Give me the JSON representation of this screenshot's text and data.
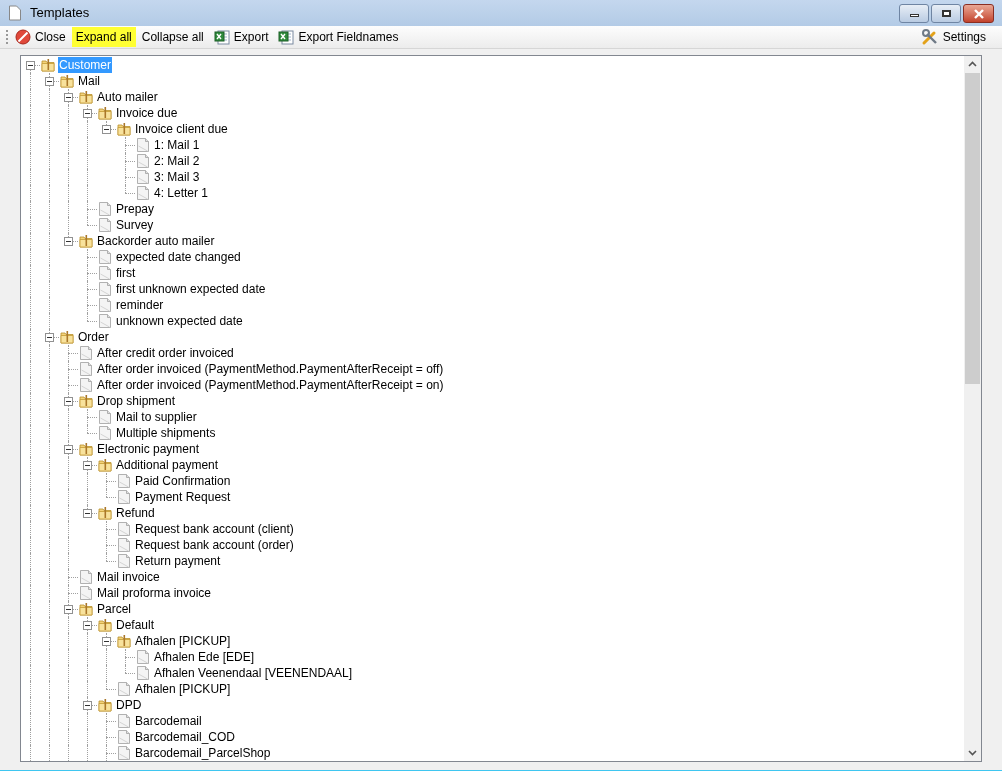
{
  "window": {
    "title": "Templates"
  },
  "toolbar": [
    {
      "kind": "close",
      "label": "Close",
      "highlighted": false
    },
    {
      "kind": "plain",
      "label": "Expand all",
      "highlighted": true
    },
    {
      "kind": "plain",
      "label": "Collapse all",
      "highlighted": false
    },
    {
      "kind": "excel",
      "label": "Export",
      "highlighted": false
    },
    {
      "kind": "excel",
      "label": "Export Fieldnames",
      "highlighted": false
    },
    {
      "kind": "settings",
      "label": "Settings",
      "highlighted": false
    }
  ],
  "tree": [
    {
      "label": "Customer",
      "kind": "folder",
      "expanded": true,
      "selected": true,
      "children": [
        {
          "label": "Mail",
          "kind": "folder",
          "expanded": true,
          "selected": false,
          "children": [
            {
              "label": "Auto mailer",
              "kind": "folder",
              "expanded": true,
              "selected": false,
              "children": [
                {
                  "label": "Invoice due",
                  "kind": "folder",
                  "expanded": true,
                  "selected": false,
                  "children": [
                    {
                      "label": "Invoice client due",
                      "kind": "folder",
                      "expanded": true,
                      "selected": false,
                      "children": [
                        {
                          "label": "1: Mail 1",
                          "kind": "doc",
                          "selected": false
                        },
                        {
                          "label": "2: Mail 2",
                          "kind": "doc",
                          "selected": false
                        },
                        {
                          "label": "3: Mail 3",
                          "kind": "doc",
                          "selected": false
                        },
                        {
                          "label": "4: Letter 1",
                          "kind": "doc",
                          "selected": false
                        }
                      ]
                    }
                  ]
                },
                {
                  "label": "Prepay",
                  "kind": "doc",
                  "selected": false
                },
                {
                  "label": "Survey",
                  "kind": "doc",
                  "selected": false
                }
              ]
            },
            {
              "label": "Backorder auto mailer",
              "kind": "folder",
              "expanded": true,
              "selected": false,
              "children": [
                {
                  "label": "expected date changed",
                  "kind": "doc",
                  "selected": false
                },
                {
                  "label": "first",
                  "kind": "doc",
                  "selected": false
                },
                {
                  "label": "first unknown expected date",
                  "kind": "doc",
                  "selected": false
                },
                {
                  "label": "reminder",
                  "kind": "doc",
                  "selected": false
                },
                {
                  "label": "unknown expected date",
                  "kind": "doc",
                  "selected": false
                }
              ]
            }
          ]
        },
        {
          "label": "Order",
          "kind": "folder",
          "expanded": true,
          "selected": false,
          "children": [
            {
              "label": "After credit order invoiced",
              "kind": "doc",
              "selected": false
            },
            {
              "label": "After order invoiced (PaymentMethod.PaymentAfterReceipt = off)",
              "kind": "doc",
              "selected": false
            },
            {
              "label": "After order invoiced (PaymentMethod.PaymentAfterReceipt = on)",
              "kind": "doc",
              "selected": false
            },
            {
              "label": "Drop shipment",
              "kind": "folder",
              "expanded": true,
              "selected": false,
              "children": [
                {
                  "label": "Mail to supplier",
                  "kind": "doc",
                  "selected": false
                },
                {
                  "label": "Multiple shipments",
                  "kind": "doc",
                  "selected": false
                }
              ]
            },
            {
              "label": "Electronic payment",
              "kind": "folder",
              "expanded": true,
              "selected": false,
              "children": [
                {
                  "label": "Additional payment",
                  "kind": "folder",
                  "expanded": true,
                  "selected": false,
                  "children": [
                    {
                      "label": "Paid Confirmation",
                      "kind": "doc",
                      "selected": false
                    },
                    {
                      "label": "Payment Request",
                      "kind": "doc",
                      "selected": false
                    }
                  ]
                },
                {
                  "label": "Refund",
                  "kind": "folder",
                  "expanded": true,
                  "selected": false,
                  "children": [
                    {
                      "label": "Request bank account (client)",
                      "kind": "doc",
                      "selected": false
                    },
                    {
                      "label": "Request bank account (order)",
                      "kind": "doc",
                      "selected": false
                    },
                    {
                      "label": "Return payment",
                      "kind": "doc",
                      "selected": false
                    }
                  ]
                }
              ]
            },
            {
              "label": "Mail invoice",
              "kind": "doc",
              "selected": false
            },
            {
              "label": "Mail proforma invoice",
              "kind": "doc",
              "selected": false
            },
            {
              "label": "Parcel",
              "kind": "folder",
              "expanded": true,
              "selected": false,
              "children": [
                {
                  "label": "Default",
                  "kind": "folder",
                  "expanded": true,
                  "selected": false,
                  "children": [
                    {
                      "label": "Afhalen [PICKUP]",
                      "kind": "folder",
                      "expanded": true,
                      "selected": false,
                      "children": [
                        {
                          "label": "Afhalen Ede [EDE]",
                          "kind": "doc",
                          "selected": false
                        },
                        {
                          "label": "Afhalen Veenendaal [VEENENDAAL]",
                          "kind": "doc",
                          "selected": false
                        }
                      ]
                    },
                    {
                      "label": "Afhalen [PICKUP]",
                      "kind": "doc",
                      "selected": false
                    }
                  ]
                },
                {
                  "label": "DPD",
                  "kind": "folder",
                  "expanded": true,
                  "selected": false,
                  "children": [
                    {
                      "label": "Barcodemail",
                      "kind": "doc",
                      "selected": false
                    },
                    {
                      "label": "Barcodemail_COD",
                      "kind": "doc",
                      "selected": false
                    },
                    {
                      "label": "Barcodemail_ParcelShop",
                      "kind": "doc",
                      "selected": false
                    }
                  ]
                }
              ]
            }
          ]
        }
      ]
    }
  ]
}
